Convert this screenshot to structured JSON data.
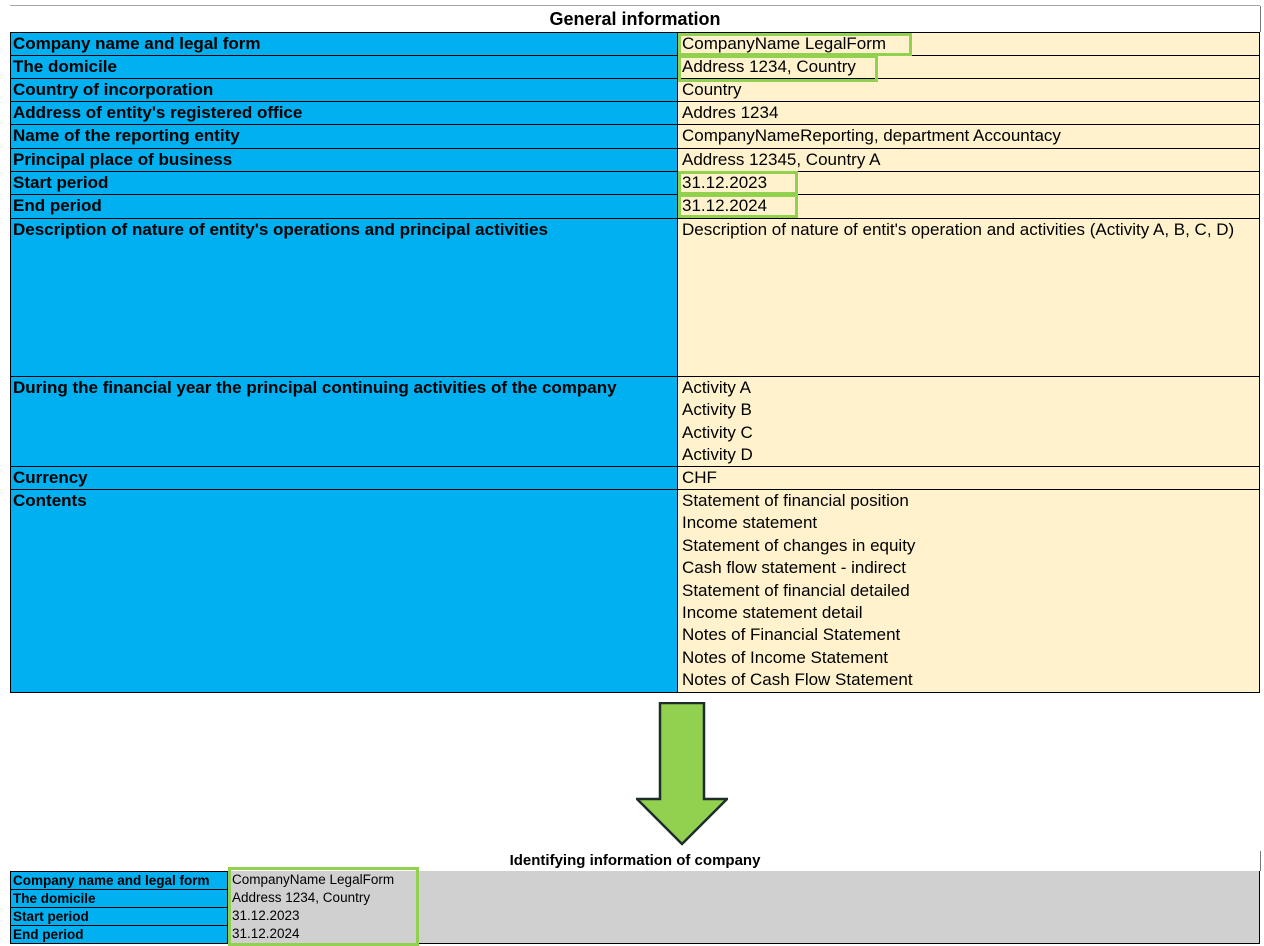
{
  "general": {
    "title": "General information",
    "rows": [
      {
        "label": "Company name and legal form",
        "values": [
          "CompanyName LegalForm"
        ]
      },
      {
        "label": "The domicile",
        "values": [
          "Address 1234, Country"
        ]
      },
      {
        "label": "Country of incorporation",
        "values": [
          "Country"
        ]
      },
      {
        "label": "Address of entity's registered office",
        "values": [
          "Addres 1234"
        ]
      },
      {
        "label": "Name of the reporting entity",
        "values": [
          "CompanyNameReporting, department Accountacy"
        ]
      },
      {
        "label": "Principal place of business",
        "values": [
          "Address 12345, Country A"
        ]
      },
      {
        "label": "Start period",
        "values": [
          "31.12.2023"
        ]
      },
      {
        "label": "End period",
        "values": [
          "31.12.2024"
        ]
      },
      {
        "label": "Description of nature of entity's operations and principal activities",
        "values": [
          "Description of nature of entit's operation and activities (Activity A, B, C, D)"
        ]
      },
      {
        "label": "During the financial year the principal continuing activities of the company",
        "values": [
          "Activity A",
          "Activity B",
          "Activity C",
          "Activity D"
        ]
      },
      {
        "label": "Currency",
        "values": [
          "CHF"
        ]
      },
      {
        "label": "Contents",
        "values": [
          "Statement of financial position",
          "Income statement",
          "Statement of changes in equity",
          "Cash flow statement - indirect",
          "Statement of financial detailed",
          "Income statement detail",
          "Notes of Financial Statement",
          "Notes of Income Statement",
          "Notes of Cash Flow Statement"
        ]
      }
    ]
  },
  "identifying": {
    "title": "Identifying information of company",
    "rows": [
      {
        "label": "Company name and legal form",
        "value": "CompanyName LegalForm"
      },
      {
        "label": "The domicile",
        "value": "Address 1234, Country"
      },
      {
        "label": "Start period",
        "value": "31.12.2023"
      },
      {
        "label": "End period",
        "value": "31.12.2024"
      }
    ]
  },
  "colors": {
    "label_fill": "#00b0f0",
    "value_fill": "#fff2cc",
    "highlight": "#92d050",
    "bottom_value_fill": "#d0d0d0"
  }
}
